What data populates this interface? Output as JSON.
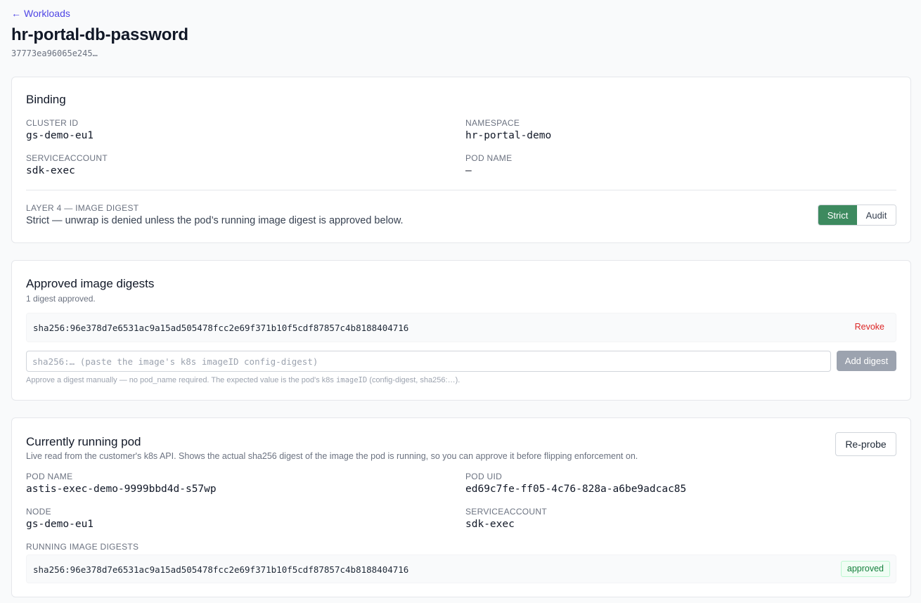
{
  "header": {
    "back_arrow": "←",
    "back_label": "Workloads",
    "title": "hr-portal-db-password",
    "id_short": "37773ea96065e245…"
  },
  "binding": {
    "title": "Binding",
    "cluster_id_label": "CLUSTER ID",
    "cluster_id": "gs-demo-eu1",
    "namespace_label": "NAMESPACE",
    "namespace": "hr-portal-demo",
    "serviceaccount_label": "SERVICEACCOUNT",
    "serviceaccount": "sdk-exec",
    "pod_name_label": "POD NAME",
    "pod_name": "—",
    "layer_label": "LAYER 4 — IMAGE DIGEST",
    "layer_description": "Strict — unwrap is denied unless the pod’s running image digest is approved below.",
    "mode_options": [
      "Strict",
      "Audit"
    ],
    "mode_selected": "Strict"
  },
  "approved": {
    "title": "Approved image digests",
    "count_text": "1 digest approved.",
    "digests": [
      {
        "value": "sha256:96e378d7e6531ac9a15ad505478fcc2e69f371b10f5cdf87857c4b8188404716",
        "action": "Revoke"
      }
    ],
    "input_placeholder": "sha256:… (paste the image's k8s imageID config-digest)",
    "input_value": "",
    "add_label": "Add digest",
    "help_prefix": "Approve a digest manually — no pod_name required. The expected value is the pod's k8s ",
    "help_code": "imageID",
    "help_suffix": " (config-digest, sha256:…)."
  },
  "running": {
    "title": "Currently running pod",
    "description": "Live read from the customer's k8s API. Shows the actual sha256 digest of the image the pod is running, so you can approve it before flipping enforcement on.",
    "reprobe_label": "Re-probe",
    "pod_name_label": "POD NAME",
    "pod_name": "astis-exec-demo-9999bbd4d-s57wp",
    "pod_uid_label": "POD UID",
    "pod_uid": "ed69c7fe-ff05-4c76-828a-a6be9adcac85",
    "node_label": "NODE",
    "node": "gs-demo-eu1",
    "serviceaccount_label": "SERVICEACCOUNT",
    "serviceaccount": "sdk-exec",
    "digests_label": "RUNNING IMAGE DIGESTS",
    "digests": [
      {
        "value": "sha256:96e378d7e6531ac9a15ad505478fcc2e69f371b10f5cdf87857c4b8188404716",
        "status": "approved"
      }
    ]
  },
  "colors": {
    "link": "#4f46e5",
    "strict_active": "#3d8a5f",
    "revoke": "#dc2626",
    "approved_badge": "#15803d"
  }
}
